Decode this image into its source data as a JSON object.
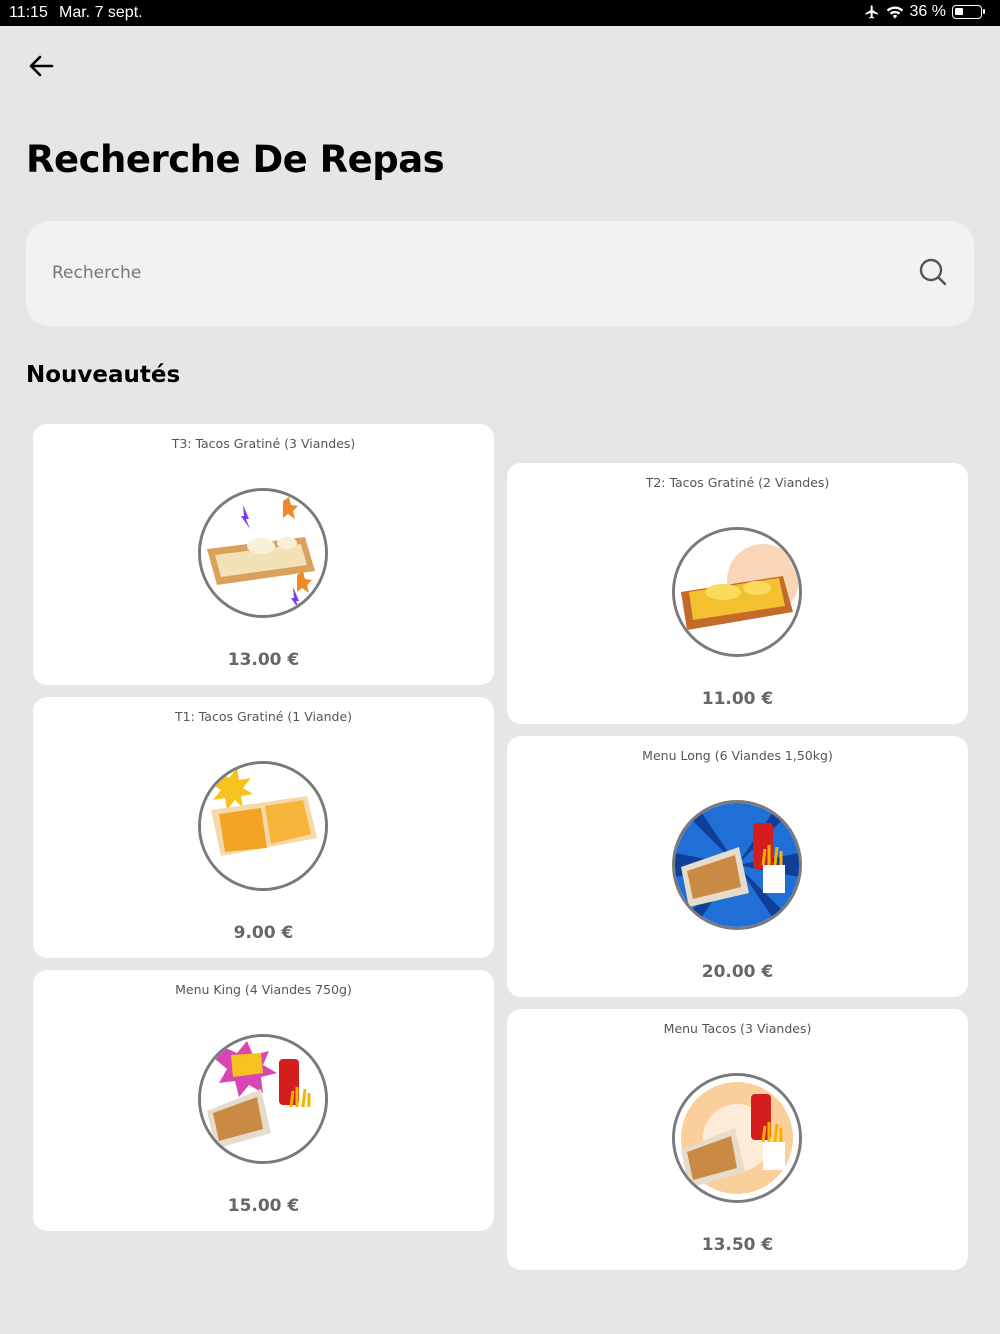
{
  "status_bar": {
    "time": "11:15",
    "date": "Mar. 7 sept.",
    "battery": "36 %"
  },
  "header": {
    "title": "Recherche De Repas"
  },
  "search": {
    "placeholder": "Recherche",
    "value": ""
  },
  "section": {
    "title": "Nouveautés"
  },
  "products": [
    {
      "name": "T3: Tacos Gratiné (3 Viandes)",
      "price": "13.00 €"
    },
    {
      "name": "T2: Tacos Gratiné (2 Viandes)",
      "price": "11.00 €"
    },
    {
      "name": "T1: Tacos Gratiné (1 Viande)",
      "price": "9.00 €"
    },
    {
      "name": "Menu Long (6 Viandes 1,50kg)",
      "price": "20.00 €"
    },
    {
      "name": "Menu King (4 Viandes 750g)",
      "price": "15.00 €"
    },
    {
      "name": "Menu Tacos (3 Viandes)",
      "price": "13.50 €"
    }
  ],
  "colors": {
    "background": "#e6e6e6",
    "card": "#ffffff",
    "search_bg": "#f2f2f2",
    "price_text": "#666666"
  }
}
